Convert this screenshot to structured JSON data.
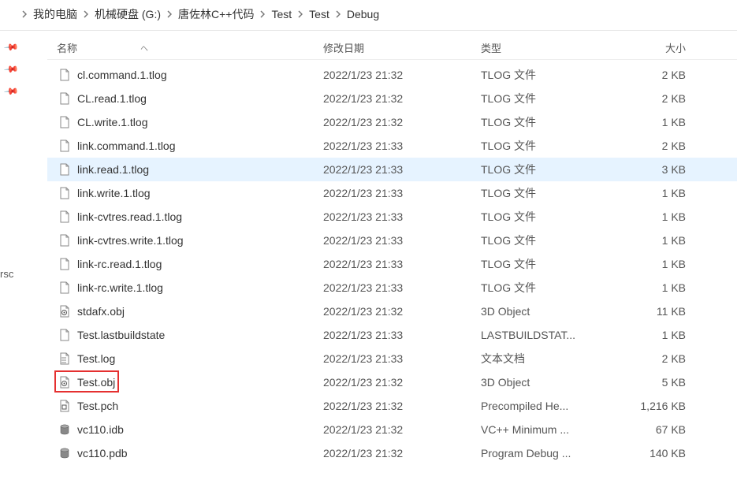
{
  "breadcrumb": [
    "我的电脑",
    "机械硬盘 (G:)",
    "唐佐林C++代码",
    "Test",
    "Test",
    "Debug"
  ],
  "leftLabel": "rsc",
  "columns": {
    "name": "名称",
    "modified": "修改日期",
    "type": "类型",
    "size": "大小"
  },
  "files": [
    {
      "icon": "file",
      "name": "cl.command.1.tlog",
      "modified": "2022/1/23 21:32",
      "type": "TLOG 文件",
      "size": "2 KB",
      "selected": false
    },
    {
      "icon": "file",
      "name": "CL.read.1.tlog",
      "modified": "2022/1/23 21:32",
      "type": "TLOG 文件",
      "size": "2 KB",
      "selected": false
    },
    {
      "icon": "file",
      "name": "CL.write.1.tlog",
      "modified": "2022/1/23 21:32",
      "type": "TLOG 文件",
      "size": "1 KB",
      "selected": false
    },
    {
      "icon": "file",
      "name": "link.command.1.tlog",
      "modified": "2022/1/23 21:33",
      "type": "TLOG 文件",
      "size": "2 KB",
      "selected": false
    },
    {
      "icon": "file",
      "name": "link.read.1.tlog",
      "modified": "2022/1/23 21:33",
      "type": "TLOG 文件",
      "size": "3 KB",
      "selected": true
    },
    {
      "icon": "file",
      "name": "link.write.1.tlog",
      "modified": "2022/1/23 21:33",
      "type": "TLOG 文件",
      "size": "1 KB",
      "selected": false
    },
    {
      "icon": "file",
      "name": "link-cvtres.read.1.tlog",
      "modified": "2022/1/23 21:33",
      "type": "TLOG 文件",
      "size": "1 KB",
      "selected": false
    },
    {
      "icon": "file",
      "name": "link-cvtres.write.1.tlog",
      "modified": "2022/1/23 21:33",
      "type": "TLOG 文件",
      "size": "1 KB",
      "selected": false
    },
    {
      "icon": "file",
      "name": "link-rc.read.1.tlog",
      "modified": "2022/1/23 21:33",
      "type": "TLOG 文件",
      "size": "1 KB",
      "selected": false
    },
    {
      "icon": "file",
      "name": "link-rc.write.1.tlog",
      "modified": "2022/1/23 21:33",
      "type": "TLOG 文件",
      "size": "1 KB",
      "selected": false
    },
    {
      "icon": "obj",
      "name": "stdafx.obj",
      "modified": "2022/1/23 21:32",
      "type": "3D Object",
      "size": "11 KB",
      "selected": false
    },
    {
      "icon": "file",
      "name": "Test.lastbuildstate",
      "modified": "2022/1/23 21:33",
      "type": "LASTBUILDSTAT...",
      "size": "1 KB",
      "selected": false
    },
    {
      "icon": "textdoc",
      "name": "Test.log",
      "modified": "2022/1/23 21:33",
      "type": "文本文档",
      "size": "2 KB",
      "selected": false
    },
    {
      "icon": "obj",
      "name": "Test.obj",
      "modified": "2022/1/23 21:32",
      "type": "3D Object",
      "size": "5 KB",
      "selected": false,
      "highlighted": true
    },
    {
      "icon": "pch",
      "name": "Test.pch",
      "modified": "2022/1/23 21:32",
      "type": "Precompiled He...",
      "size": "1,216 KB",
      "selected": false
    },
    {
      "icon": "db",
      "name": "vc110.idb",
      "modified": "2022/1/23 21:32",
      "type": "VC++ Minimum ...",
      "size": "67 KB",
      "selected": false
    },
    {
      "icon": "db",
      "name": "vc110.pdb",
      "modified": "2022/1/23 21:32",
      "type": "Program Debug ...",
      "size": "140 KB",
      "selected": false
    }
  ]
}
